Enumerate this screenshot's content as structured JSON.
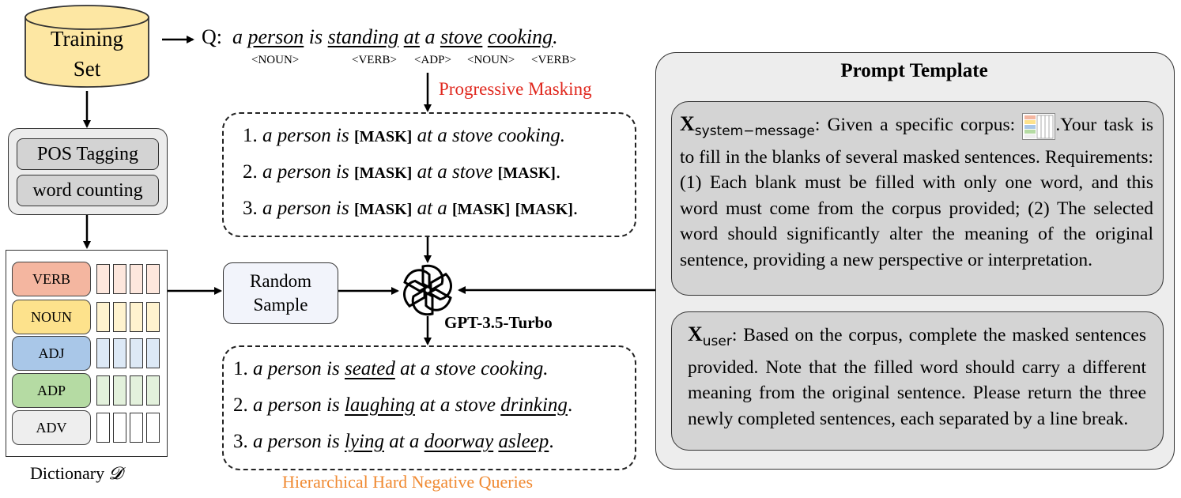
{
  "training_set": {
    "line1": "Training",
    "line2": "Set"
  },
  "query": {
    "prefix": "Q:",
    "words": [
      "a",
      "person",
      "is",
      "standing",
      "at",
      "a",
      "stove",
      "cooking",
      "."
    ],
    "tags": [
      "<NOUN>",
      "<VERB>",
      "<ADP>",
      "<NOUN>",
      "<VERB>"
    ]
  },
  "pos_tagging": {
    "item1": "POS Tagging",
    "item2": "word counting"
  },
  "dictionary": {
    "pos": [
      "VERB",
      "NOUN",
      "ADJ",
      "ADP",
      "ADV"
    ],
    "colors": {
      "verb": "#f4b6a0",
      "noun": "#fde28c",
      "adj": "#a9c7e8",
      "adp": "#b5dba3",
      "adv": "#eeeeee"
    },
    "cell_colors": {
      "verb": "#fde7dd",
      "noun": "#fff3cf",
      "adj": "#dde9f6",
      "adp": "#e3f1dc",
      "adv": "#ffffff"
    },
    "label_prefix": "Dictionary",
    "label_symbol": "𝓓"
  },
  "progressive_masking": {
    "label": "Progressive Masking",
    "lines": [
      {
        "num": "1.",
        "a": "a person is",
        "m1": "[MASK]",
        "b": "at a stove cooking.",
        "m2": "",
        "m3": "",
        "end": ""
      },
      {
        "num": "2.",
        "a": "a person is",
        "m1": "[MASK]",
        "b": "at a stove",
        "m2": "[MASK]",
        "m3": "",
        "end": "."
      },
      {
        "num": "3.",
        "a": "a person is",
        "m1": "[MASK]",
        "b": "at a",
        "m2": "[MASK]",
        "m3": "[MASK]",
        "end": "."
      }
    ]
  },
  "random_sample": {
    "line1": "Random",
    "line2": "Sample"
  },
  "model": "GPT-3.5-Turbo",
  "hard_negatives": {
    "label": "Hierarchical Hard Negative Queries",
    "lines": [
      {
        "num": "1.",
        "a": "a person is",
        "w1": "seated",
        "b": "at a stove cooking.",
        "w2": "",
        "c": "",
        "w3": "",
        "end": ""
      },
      {
        "num": "2.",
        "a": "a person is",
        "w1": "laughing",
        "b": "at a stove",
        "w2": "drinking",
        "c": "",
        "w3": "",
        "end": "."
      },
      {
        "num": "3.",
        "a": "a person is",
        "w1": "lying",
        "b": "at a",
        "w2": "doorway",
        "c": "",
        "w3": "asleep",
        "end": "."
      }
    ]
  },
  "prompt_template": {
    "title": "Prompt Template",
    "system": {
      "var": "X",
      "sub": "system−message",
      "text_before": ": Given a specific corpus:",
      "text_after": ".Your task is to fill in the blanks of several masked sentences. Requirements: (1) Each blank must be filled with only one word, and this word must come from the corpus provided; (2) The selected word should significantly alter the meaning of the original sentence, providing a new perspective or interpretation."
    },
    "user": {
      "var": "X",
      "sub": "user",
      "text": ": Based on the corpus, complete the masked sentences provided. Note that the filled word should carry a different meaning from the original sentence. Please return the three newly completed sentences, each separated by a line break."
    }
  }
}
